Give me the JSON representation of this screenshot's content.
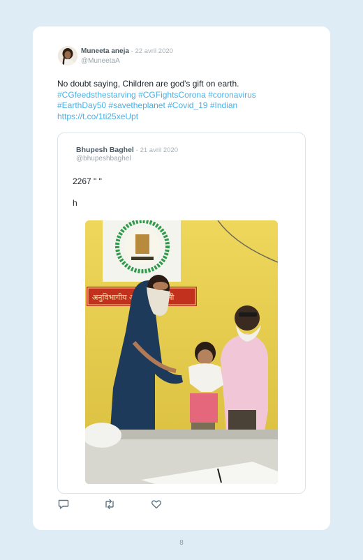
{
  "tweet": {
    "author_name": "Muneeta aneja",
    "date": "22 avril 2020",
    "handle": "@MuneetaA",
    "text_line1": "No doubt saying, Children are god's gift on earth.",
    "hashtags_line2": "#CGfeedsthestarving #CGFightsCorona #coronavirus",
    "hashtags_line3": "#EarthDay50 #savetheplanet #Covid_19 #Indian",
    "link": "https://t.co/1ti25xeUpt"
  },
  "quoted_tweet": {
    "author_name": "Bhupesh Baghel",
    "date": "21 avril 2020",
    "handle": "@bhupeshbaghel",
    "text_line1": "2267 \" \"",
    "text_line2": "h",
    "photo_sign_text": "अनुविभागीय अधिकारी लोरमी"
  },
  "actions": {
    "reply_icon": "reply-icon",
    "retweet_icon": "retweet-icon",
    "like_icon": "heart-icon"
  },
  "page": {
    "number": "8"
  },
  "colors": {
    "background": "#deedf5",
    "card": "#ffffff",
    "link": "#4ab1e6",
    "text": "#1c2429",
    "muted": "#9aa6ad"
  }
}
